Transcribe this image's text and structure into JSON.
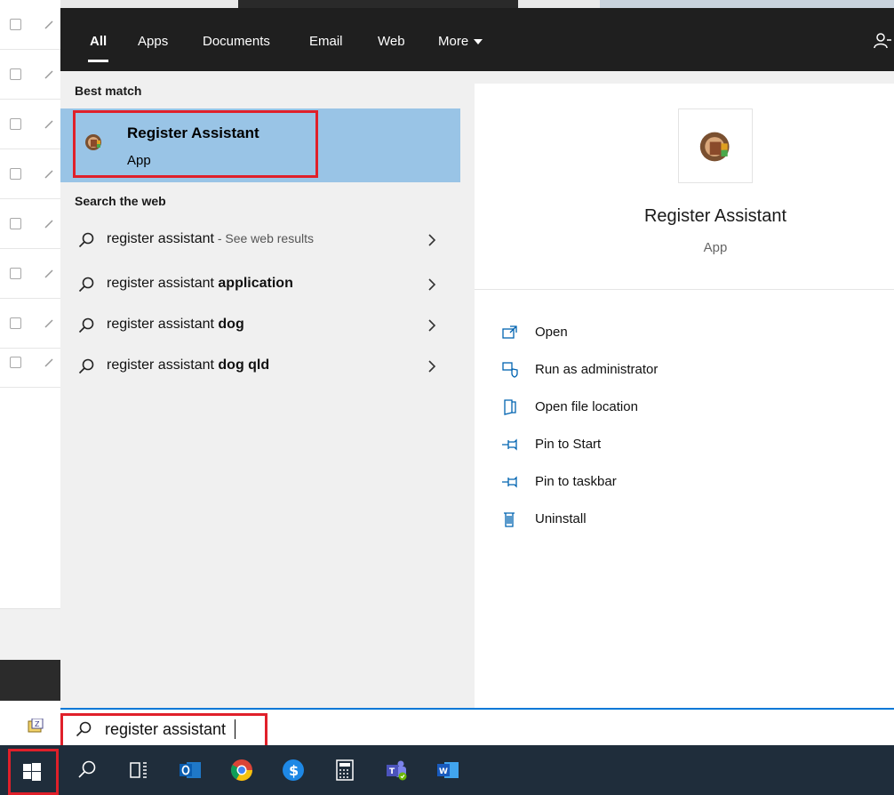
{
  "filters": {
    "tabs": [
      "All",
      "Apps",
      "Documents",
      "Email",
      "Web",
      "More"
    ],
    "active": "All"
  },
  "results": {
    "best_match_header": "Best match",
    "best_match": {
      "name": "Register Assistant",
      "type": "App"
    },
    "web_header": "Search the web",
    "web_items": [
      {
        "prefix": "register assistant",
        "bold": "",
        "suffix": " - See web results"
      },
      {
        "prefix": "register assistant ",
        "bold": "application",
        "suffix": ""
      },
      {
        "prefix": "register assistant ",
        "bold": "dog",
        "suffix": ""
      },
      {
        "prefix": "register assistant ",
        "bold": "dog qld",
        "suffix": ""
      }
    ]
  },
  "preview": {
    "name": "Register Assistant",
    "type": "App",
    "actions": [
      "Open",
      "Run as administrator",
      "Open file location",
      "Pin to Start",
      "Pin to taskbar",
      "Uninstall"
    ]
  },
  "search": {
    "value": "register assistant"
  },
  "taskbar": {
    "items": [
      "search-icon",
      "task-view-icon",
      "outlook-icon",
      "chrome-icon",
      "dollar-app-icon",
      "calculator-icon",
      "teams-icon",
      "word-icon"
    ]
  },
  "colors": {
    "selection": "#99c4e6",
    "highlight_border": "#e0202a",
    "accent": "#0078d7",
    "taskbar": "#1f2d3b",
    "filter_bar": "#1f1f1f"
  }
}
